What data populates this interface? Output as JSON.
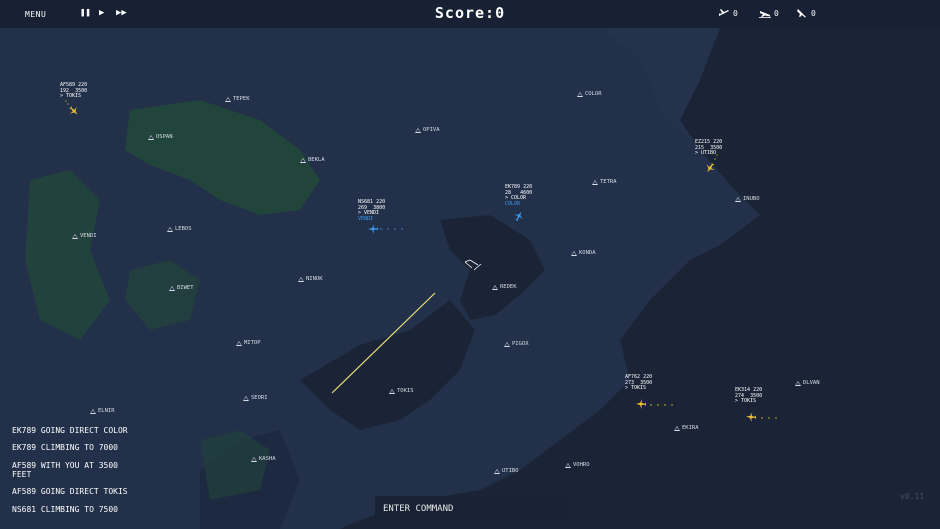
{
  "topbar": {
    "menu_label": "MENU",
    "score_label": "Score",
    "score_value": 0
  },
  "stats": [
    {
      "icon": "plane-icon",
      "value": "0"
    },
    {
      "icon": "landing-icon",
      "value": "0"
    },
    {
      "icon": "crash-icon",
      "value": "0"
    }
  ],
  "waypoints": [
    "TEPEK",
    "OSPAN",
    "OPIVA",
    "BEKLA",
    "COLOR",
    "TETRA",
    "INUBO",
    "VENDI",
    "LEBOS",
    "KONDA",
    "NINOK",
    "REDEK",
    "BIWET",
    "MITOP",
    "PIGOX",
    "TOKIS",
    "SEORI",
    "ELNIR",
    "KASHA",
    "UTIBO",
    "VOHRO",
    "EKIRA",
    "DLVAN"
  ],
  "aircraft": [
    {
      "callsign": "AF589",
      "speed": "220",
      "heading": "192",
      "altitude": "3500",
      "direct": "> TOKIS",
      "color": "#f4c430"
    },
    {
      "callsign": "EZ215",
      "speed": "220",
      "heading": "215",
      "altitude": "3500",
      "direct": "> UTIBO",
      "color": "#f4c430"
    },
    {
      "callsign": "EK789",
      "speed": "220",
      "heading": "28",
      "altitude": "4600",
      "direct": "> COLOR",
      "pending": "COLOR",
      "color": "#3a9bf0"
    },
    {
      "callsign": "NS681",
      "speed": "220",
      "heading": "269",
      "altitude": "3800",
      "direct": "> VENDI",
      "pending": "VENDI",
      "color": "#3a9bf0"
    },
    {
      "callsign": "AF762",
      "speed": "220",
      "heading": "273",
      "altitude": "3500",
      "direct": "> TOKIS",
      "color": "#f4c430"
    },
    {
      "callsign": "EK314",
      "speed": "220",
      "heading": "274",
      "altitude": "3500",
      "direct": "> TOKIS",
      "color": "#f4c430"
    }
  ],
  "log": [
    "EK789 GOING DIRECT COLOR",
    "EK789 CLIMBING TO 7000",
    "AF589 WITH YOU AT 3500 FEET",
    "AF589 GOING DIRECT TOKIS",
    "NS681 CLIMBING TO 7500"
  ],
  "command": {
    "placeholder": "ENTER COMMAND"
  },
  "version": "v0.11",
  "colors": {
    "sea": "#1a2436",
    "land": "#22304a",
    "green": "#22453b",
    "approach": "#e8e07a"
  }
}
